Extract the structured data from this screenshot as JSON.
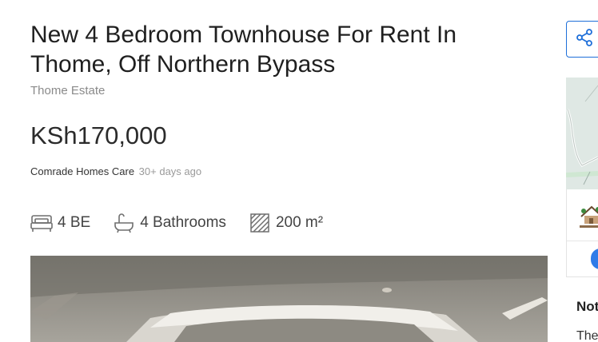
{
  "listing": {
    "title": "New 4 Bedroom Townhouse For Rent In Thome, Off Northern Bypass",
    "location": "Thome Estate",
    "price": "KSh170,000",
    "agent_name": "Comrade Homes Care",
    "posted": "30+ days ago",
    "features": [
      {
        "icon": "bed-icon",
        "label": "4 BE"
      },
      {
        "icon": "bathtub-icon",
        "label": "4 Bathrooms"
      },
      {
        "icon": "area-icon",
        "label": "200 m²"
      }
    ]
  },
  "sidebar": {
    "share_icon": "share-icon",
    "notes_heading": "Not",
    "notes_text": "The"
  },
  "colors": {
    "accent": "#1e6fd9",
    "muted_text": "#8a8a8a"
  }
}
